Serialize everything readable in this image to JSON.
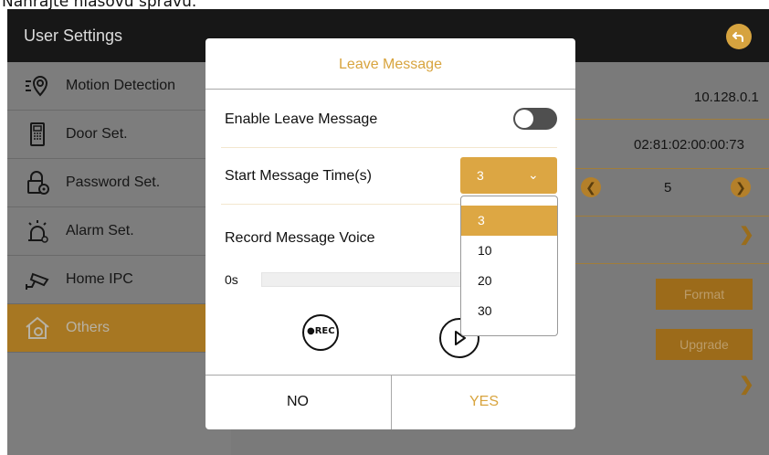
{
  "caption": "Nahrajte hlasovú správu.",
  "app": {
    "title": "User Settings"
  },
  "sidebar": {
    "items": [
      {
        "label": "Motion Detection",
        "icon": "motion-detection-icon",
        "active": false
      },
      {
        "label": "Door Set.",
        "icon": "door-panel-icon",
        "active": false
      },
      {
        "label": "Password Set.",
        "icon": "lock-gear-icon",
        "active": false
      },
      {
        "label": "Alarm Set.",
        "icon": "alarm-bell-icon",
        "active": false
      },
      {
        "label": "Home IPC",
        "icon": "camera-icon",
        "active": false
      },
      {
        "label": "Others",
        "icon": "house-gear-icon",
        "active": true
      }
    ]
  },
  "content": {
    "ip_address": "10.128.0.1",
    "mac_address": "02:81:02:00:00:73",
    "stepper_value": "5",
    "format_label": "Format",
    "upgrade_label": "Upgrade"
  },
  "dialog": {
    "title": "Leave Message",
    "enable_label": "Enable Leave Message",
    "enable_on": false,
    "start_time_label": "Start Message Time(s)",
    "start_time_value": "3",
    "start_time_options": [
      "3",
      "10",
      "20",
      "30"
    ],
    "record_label": "Record Message Voice",
    "progress_time": "0s",
    "progress_fraction": 0,
    "rec_label": "●REC",
    "no_label": "NO",
    "yes_label": "YES"
  },
  "colors": {
    "accent": "#dca643",
    "topbar": "#171717",
    "overlay_gray": "#7c7c7c",
    "active_item": "#a77722"
  }
}
